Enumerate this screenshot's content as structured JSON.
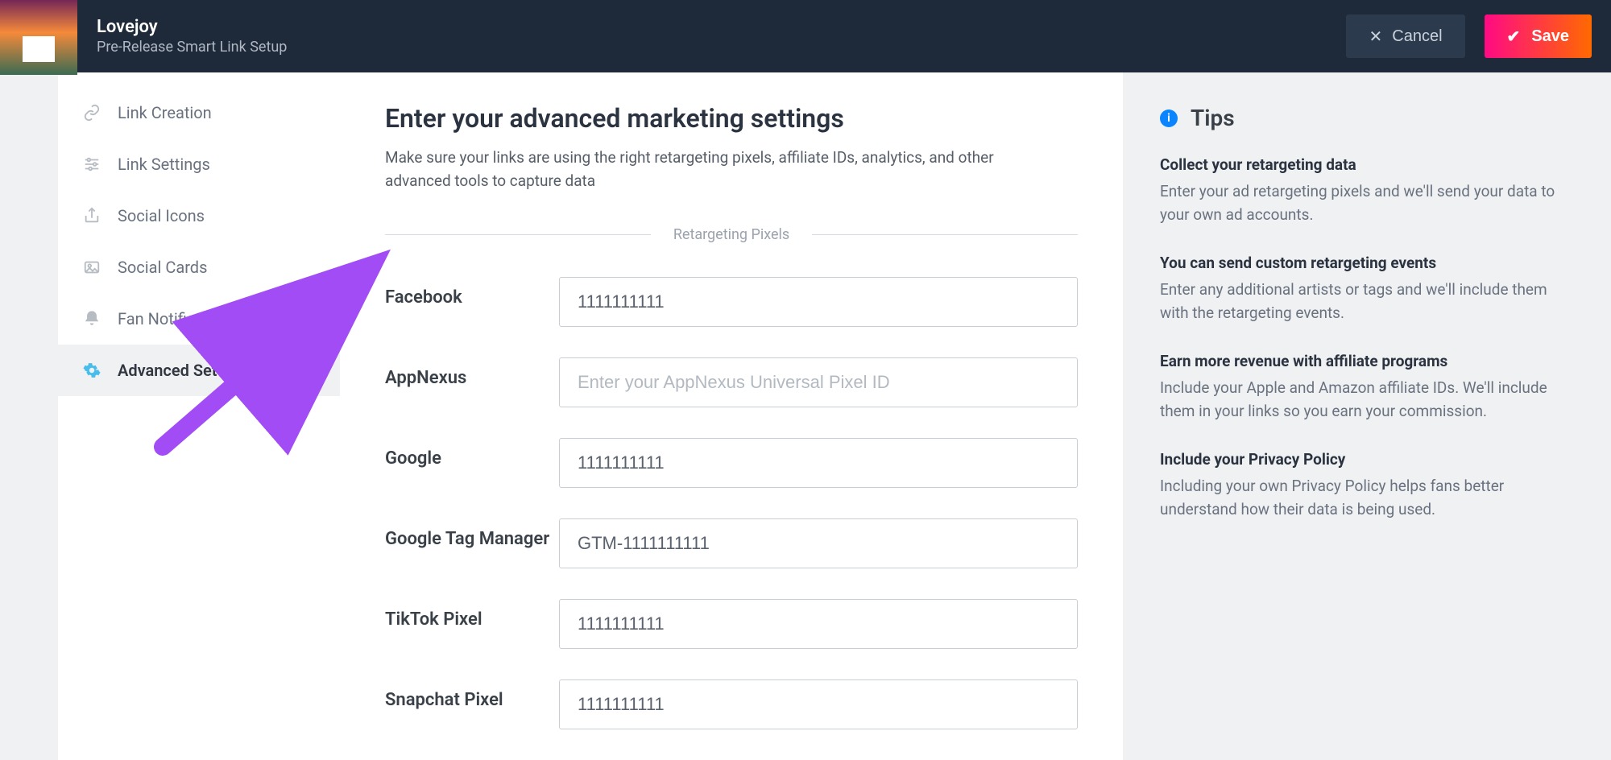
{
  "header": {
    "title": "Lovejoy",
    "subtitle": "Pre-Release Smart Link Setup",
    "cancel_label": "Cancel",
    "save_label": "Save"
  },
  "sidebar": {
    "items": [
      {
        "id": "link-creation",
        "label": "Link Creation",
        "icon": "link-icon"
      },
      {
        "id": "link-settings",
        "label": "Link Settings",
        "icon": "sliders-icon"
      },
      {
        "id": "social-icons",
        "label": "Social Icons",
        "icon": "share-icon"
      },
      {
        "id": "social-cards",
        "label": "Social Cards",
        "icon": "image-icon"
      },
      {
        "id": "fan-notifications",
        "label": "Fan Notifications",
        "icon": "bell-icon"
      },
      {
        "id": "advanced-settings",
        "label": "Advanced Settings",
        "icon": "gear-icon"
      }
    ],
    "active_id": "advanced-settings"
  },
  "main": {
    "heading": "Enter your advanced marketing settings",
    "lead": "Make sure your links are using the right retargeting pixels, affiliate IDs, analytics, and other advanced tools to capture data",
    "section_label": "Retargeting Pixels",
    "fields": [
      {
        "id": "facebook",
        "label": "Facebook",
        "value": "1111111111",
        "placeholder": ""
      },
      {
        "id": "appnexus",
        "label": "AppNexus",
        "value": "",
        "placeholder": "Enter your AppNexus Universal Pixel ID"
      },
      {
        "id": "google",
        "label": "Google",
        "value": "1111111111",
        "placeholder": ""
      },
      {
        "id": "gtm",
        "label": "Google Tag Manager",
        "value": "GTM-1111111111",
        "placeholder": ""
      },
      {
        "id": "tiktok",
        "label": "TikTok Pixel",
        "value": "1111111111",
        "placeholder": ""
      },
      {
        "id": "snapchat",
        "label": "Snapchat Pixel",
        "value": "1111111111",
        "placeholder": ""
      }
    ]
  },
  "tips": {
    "heading": "Tips",
    "items": [
      {
        "title": "Collect your retargeting data",
        "body": "Enter your ad retargeting pixels and we'll send your data to your own ad accounts."
      },
      {
        "title": "You can send custom retargeting events",
        "body": "Enter any additional artists or tags and we'll include them with the retargeting events."
      },
      {
        "title": "Earn more revenue with affiliate programs",
        "body": "Include your Apple and Amazon affiliate IDs. We'll include them in your links so you earn your commission."
      },
      {
        "title": "Include your Privacy Policy",
        "body": "Including your own Privacy Policy helps fans better understand how their data is being used."
      }
    ]
  },
  "annotation": {
    "type": "arrow",
    "color": "#a24cf5",
    "points_to": "sidebar-item-advanced-settings"
  }
}
